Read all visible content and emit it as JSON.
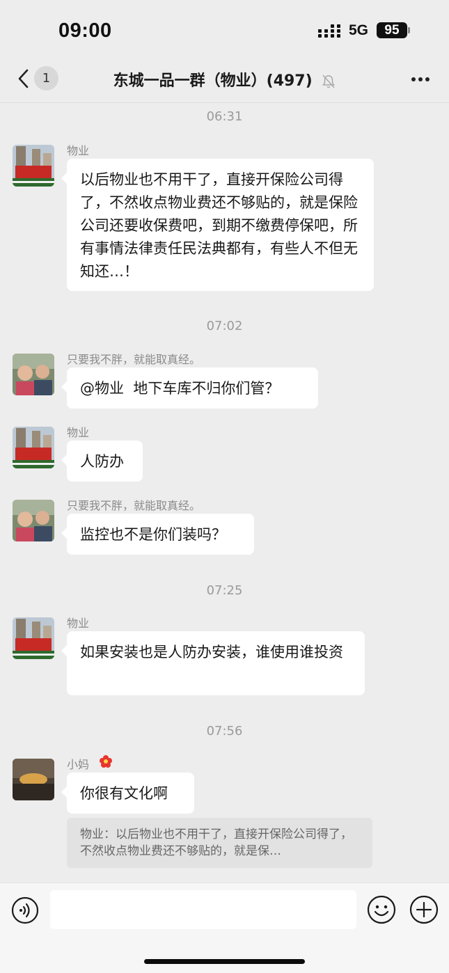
{
  "status_bar": {
    "time": "09:00",
    "network": "5G",
    "battery": "95"
  },
  "header": {
    "unread_count": "1",
    "title": "东城一品一群（物业）(497)"
  },
  "timestamps": [
    "06:31",
    "07:02",
    "07:25",
    "07:56"
  ],
  "messages": [
    {
      "sender": "物业",
      "text": "以后物业也不用干了，直接开保险公司得了，不然收点物业费还不够贴的，就是保险公司还要收保费吧，到期不缴费停保吧，所有事情法律责任民法典都有，有些人不但无知还…！"
    },
    {
      "sender": "只要我不胖，就能取真经。",
      "text": "@物业  地下车库不归你们管？"
    },
    {
      "sender": "物业",
      "text": "人防办"
    },
    {
      "sender": "只要我不胖，就能取真经。",
      "text": "监控也不是你们装吗？"
    },
    {
      "sender": "物业",
      "text": "如果安装也是人防办安装，谁使用谁投资"
    },
    {
      "sender": "小妈",
      "text": "你很有文化啊",
      "quote": "物业：以后物业也不用干了，直接开保险公司得了，不然收点物业费还不够贴的，就是保…"
    }
  ],
  "input": {
    "value": ""
  },
  "colors": {
    "background": "#ededed",
    "bubble": "#ffffff",
    "timestamp": "#9a9a9a",
    "sender": "#8a8a8a",
    "quote_bg": "#e2e2e2"
  },
  "icons": [
    "back-icon",
    "mute-bell-icon",
    "more-icon",
    "voice-icon",
    "emoji-icon",
    "add-icon",
    "flower-badge-icon"
  ]
}
